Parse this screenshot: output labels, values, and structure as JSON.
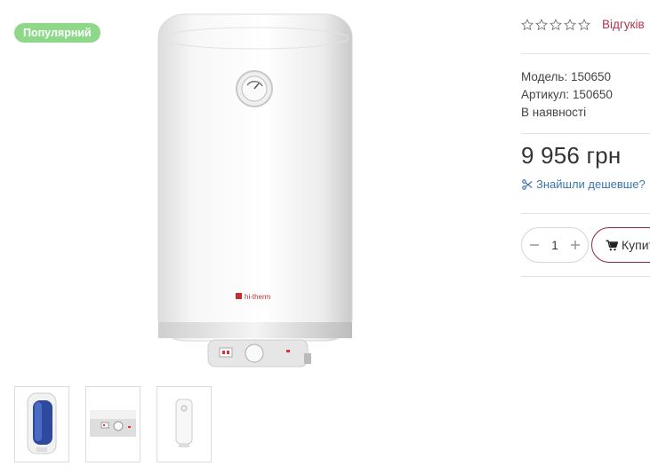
{
  "badge": {
    "label": "Популярний",
    "color": "#8ed88a"
  },
  "product_image": {
    "brand_text": "hi-therm"
  },
  "thumbnails": [
    {
      "name": "thumbnail-blue-cutaway"
    },
    {
      "name": "thumbnail-control-panel"
    },
    {
      "name": "thumbnail-heater-small"
    }
  ],
  "rating": {
    "stars": 0,
    "max": 5,
    "reviews_label": "Відгуків"
  },
  "meta": {
    "model": "Модель: 150650",
    "article": "Артикул: 150650",
    "availability": "В наявності"
  },
  "price": {
    "text": "9 956 грн"
  },
  "cheaper": {
    "label": "Знайшли дешевше?",
    "icon": "scissors-icon"
  },
  "quantity": {
    "value": "1",
    "minus_icon": "minus-icon",
    "plus_icon": "plus-icon"
  },
  "buy": {
    "label": "Купити",
    "icon": "cart-icon",
    "accent": "#8c2744"
  },
  "colors": {
    "link_reviews": "#b2344f",
    "link_cheaper": "#3a75b0",
    "divider": "#e3e3e3"
  }
}
